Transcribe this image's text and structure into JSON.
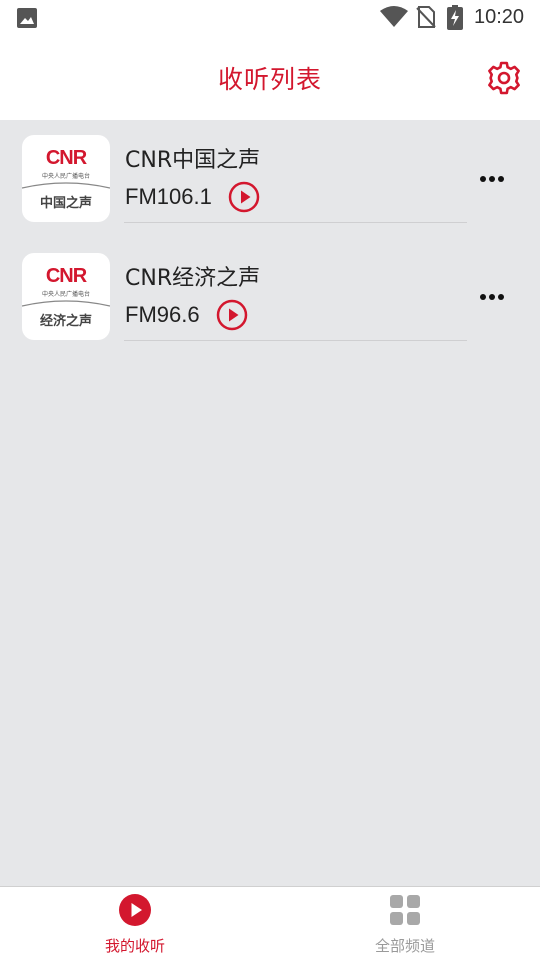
{
  "status_bar": {
    "time": "10:20"
  },
  "header": {
    "title": "收听列表"
  },
  "stations": [
    {
      "logo_brand": "CNR",
      "logo_subtitle": "中央人民广播电台",
      "logo_name": "中国之声",
      "name": "CNR中国之声",
      "frequency": "FM106.1"
    },
    {
      "logo_brand": "CNR",
      "logo_subtitle": "中央人民广播电台",
      "logo_name": "经济之声",
      "name": "CNR经济之声",
      "frequency": "FM96.6"
    }
  ],
  "bottom_nav": [
    {
      "label": "我的收听",
      "icon": "play-circle-icon",
      "active": true
    },
    {
      "label": "全部频道",
      "icon": "grid-icon",
      "active": false
    }
  ],
  "colors": {
    "accent": "#d3172e",
    "background": "#e6e7e9",
    "inactive": "#9a9a9a"
  }
}
